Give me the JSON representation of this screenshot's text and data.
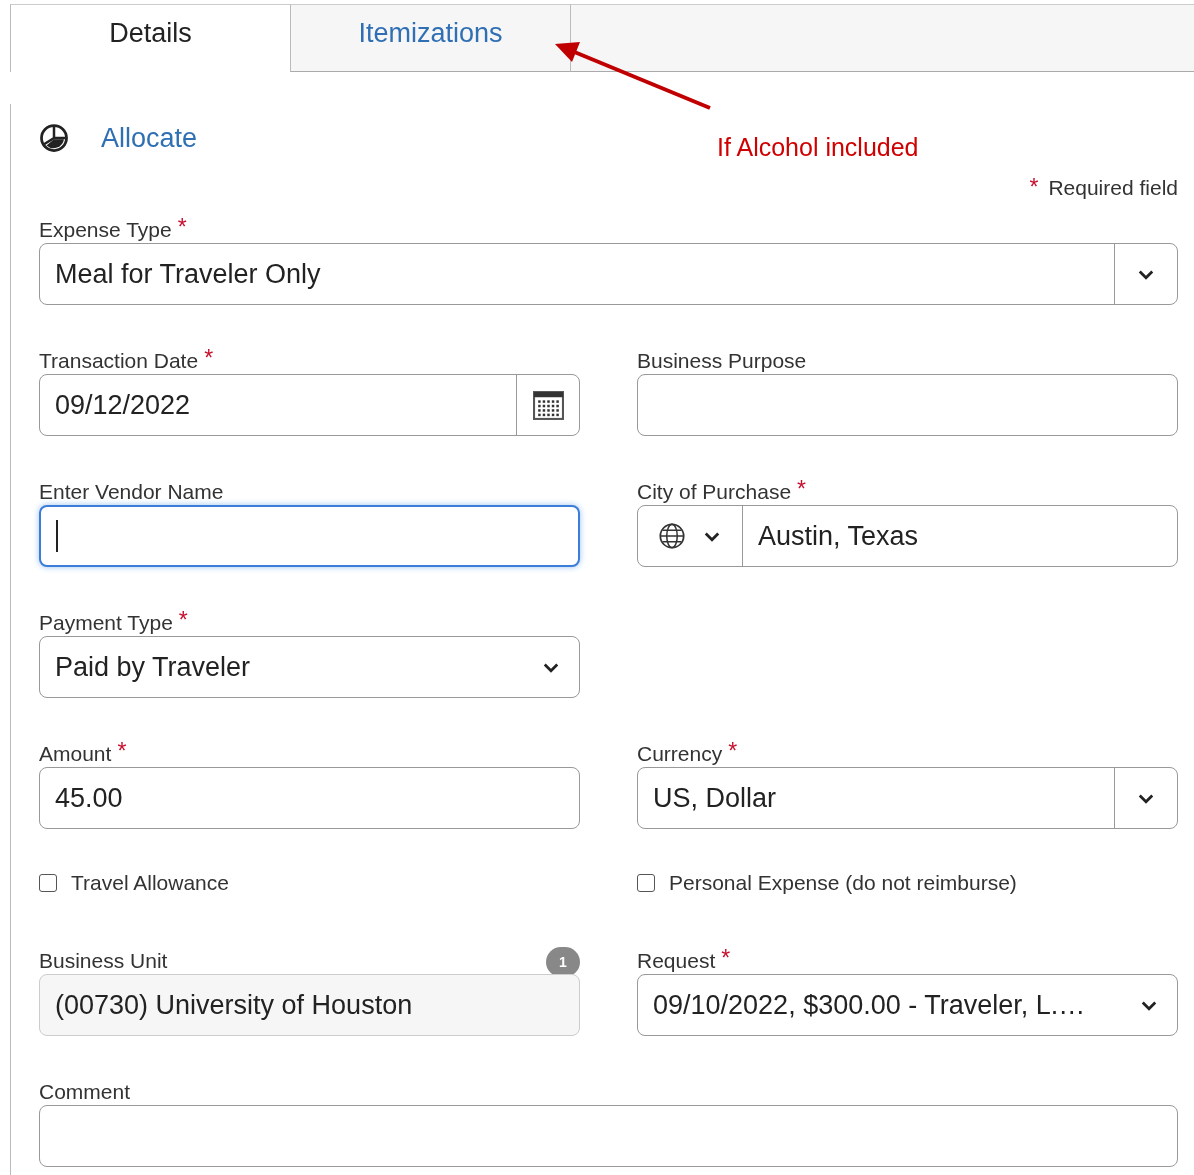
{
  "tabs": [
    {
      "label": "Details",
      "selected": true
    },
    {
      "label": "Itemizations",
      "selected": false
    }
  ],
  "allocate": {
    "label": "Allocate"
  },
  "annotation": {
    "text": "If Alcohol included"
  },
  "required_note": {
    "mark": "*",
    "text": "Required field"
  },
  "rows": [
    [
      {
        "kind": "combo",
        "label": "Expense Type",
        "required": true,
        "value": "Meal for Traveler Only",
        "span": true
      }
    ],
    [
      {
        "kind": "date",
        "label": "Transaction Date",
        "required": true,
        "value": "09/12/2022"
      },
      {
        "kind": "text",
        "label": "Business Purpose",
        "required": false
      }
    ],
    [
      {
        "kind": "text",
        "label": "Enter Vendor Name",
        "required": false,
        "focused": true
      },
      {
        "kind": "city",
        "label": "City of Purchase",
        "required": true,
        "value": "Austin, Texas"
      }
    ],
    [
      {
        "kind": "select",
        "label": "Payment Type",
        "required": true,
        "value": "Paid by Traveler"
      }
    ],
    [
      {
        "kind": "text",
        "label": "Amount",
        "required": true,
        "value": "45.00"
      },
      {
        "kind": "combo",
        "label": "Currency",
        "required": true,
        "value": "US, Dollar"
      }
    ],
    [
      {
        "kind": "checkbox",
        "label": "Travel Allowance",
        "checked": false
      },
      {
        "kind": "checkbox",
        "label": "Personal Expense (do not reimburse)",
        "checked": false
      }
    ],
    [
      {
        "kind": "readonly",
        "label": "Business Unit",
        "required": false,
        "value": "(00730) University of Houston",
        "badge": "1"
      },
      {
        "kind": "select",
        "label": "Request",
        "required": true,
        "value": "09/10/2022, $300.00 - Traveler, L.…"
      }
    ],
    [
      {
        "kind": "text",
        "label": "Comment",
        "required": false,
        "span": true
      }
    ]
  ]
}
